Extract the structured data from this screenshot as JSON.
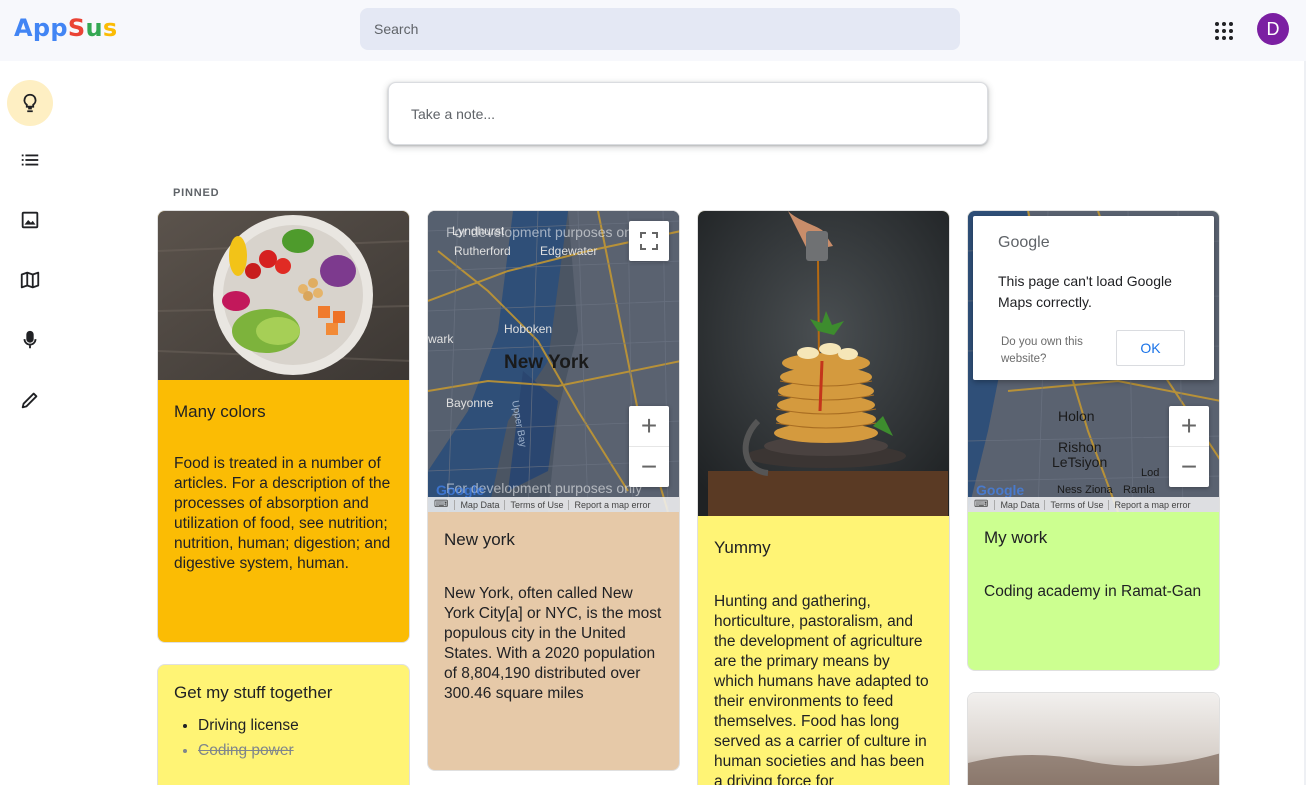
{
  "app": {
    "logo_letters": [
      {
        "ch": "A",
        "color": "#4285f4"
      },
      {
        "ch": "p",
        "color": "#4285f4"
      },
      {
        "ch": "p",
        "color": "#4285f4"
      },
      {
        "ch": "S",
        "color": "#ea4335"
      },
      {
        "ch": "u",
        "color": "#34a853"
      },
      {
        "ch": "s",
        "color": "#fbbc05"
      }
    ],
    "search_placeholder": "Search",
    "apps_icon": "apps-grid-icon",
    "avatar_letter": "D",
    "avatar_color": "#7b1fa2"
  },
  "sidebar": {
    "items": [
      {
        "name": "notes",
        "icon": "lightbulb-icon",
        "active": true
      },
      {
        "name": "todos",
        "icon": "list-icon",
        "active": false
      },
      {
        "name": "images",
        "icon": "image-icon",
        "active": false
      },
      {
        "name": "maps",
        "icon": "map-icon",
        "active": false
      },
      {
        "name": "audio",
        "icon": "microphone-icon",
        "active": false
      },
      {
        "name": "draw",
        "icon": "pencil-icon",
        "active": false
      }
    ]
  },
  "composer": {
    "placeholder": "Take a note..."
  },
  "pinned_label": "PINNED",
  "notes": [
    {
      "id": "many-colors",
      "color": "#fbbc04",
      "media": "food-bowl-photo",
      "title": "Many colors",
      "body": "Food is treated in a number of articles. For a description of the processes of absorption and utilization of food, see nutrition; nutrition, human; digestion; and digestive system, human."
    },
    {
      "id": "new-york",
      "color": "#e6c9a8",
      "media": "map",
      "map_labels": [
        "Rutherford",
        "Edgewater",
        "Hoboken",
        "New York",
        "Bayonne",
        "wark",
        "Upper Bay"
      ],
      "map_watermark": "For development purposes only",
      "title": "New york",
      "body": "New York, often called New York City[a] or NYC, is the most populous city in the United States. With a 2020 population of 8,804,190 distributed over 300.46 square miles"
    },
    {
      "id": "yummy",
      "color": "#fff475",
      "media": "pancakes-photo",
      "title": "Yummy",
      "body": "Hunting and gathering, horticulture, pastoralism, and the development of agriculture are the primary means by which humans have adapted to their environments to feed themselves. Food has long served as a carrier of culture in human societies and has been a driving force for"
    },
    {
      "id": "my-work",
      "color": "#ccff90",
      "media": "map",
      "map_labels": [
        "Holon",
        "Rishon",
        "LeTsiyon",
        "Ness Ziona",
        "Ramla",
        "Lod"
      ],
      "title": "My work",
      "body": "Coding academy in Ramat-Gan"
    },
    {
      "id": "get-my-stuff",
      "color": "#fff475",
      "title": "Get my stuff together",
      "todos": [
        {
          "text": "Driving license",
          "done": false
        },
        {
          "text": "Coding power",
          "done": true
        }
      ]
    }
  ],
  "map_ui": {
    "zoom_in": "+",
    "zoom_out": "−",
    "map_data": "Map Data",
    "terms": "Terms of Use",
    "report": "Report a map error",
    "google": "Google"
  },
  "gmaps_error": {
    "logo": "Google",
    "message": "This page can't load Google Maps correctly.",
    "own_site": "Do you own this website?",
    "ok_label": "OK"
  }
}
